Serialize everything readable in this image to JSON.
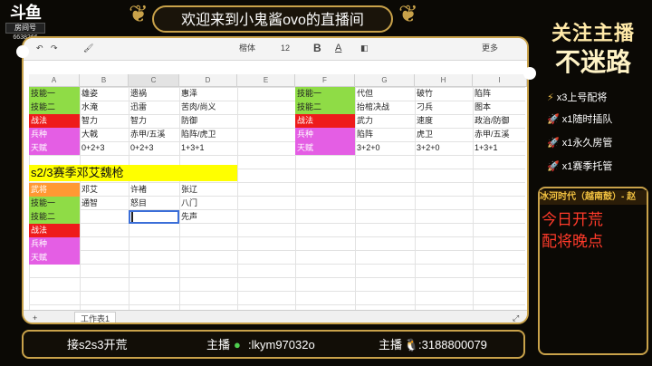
{
  "logo": {
    "brand": "斗鱼",
    "sub": "房间号",
    "room": "6638266"
  },
  "title": "欢迎来到小鬼酱ovo的直播间",
  "follow": {
    "line1": "关注主播",
    "line2": "不迷路"
  },
  "perks": [
    {
      "icon": "lightning-icon",
      "text": "x3上号配将"
    },
    {
      "icon": "rocket-icon",
      "text": "x1随时插队"
    },
    {
      "icon": "rocket-icon",
      "text": "x1永久房管"
    },
    {
      "icon": "rocket-icon",
      "text": "x1赛季托管"
    }
  ],
  "ticker": "冰河时代（越南鼓）- 赵",
  "notice": {
    "line1": "今日开荒",
    "line2": "配将晚点"
  },
  "bottom": {
    "left": "接s2s3开荒",
    "wechat_label": "主播",
    "wechat": ":lkym97032o",
    "qq_label": "主播",
    "qq": ":3188800079"
  },
  "toolbar": {
    "font": "楷体",
    "size": "12",
    "bold": "B",
    "more": "更多"
  },
  "columns": [
    "A",
    "B",
    "C",
    "D",
    "E",
    "F",
    "G",
    "H",
    "I"
  ],
  "colors": {
    "green": "#8fdc46",
    "red": "#ee1b1b",
    "pink": "#e45ee4",
    "orange": "#ff9933",
    "yellow": "#ffff00",
    "gold": "#c9a24a"
  },
  "table_left": {
    "rows": [
      {
        "label": "技能一",
        "cells": [
          "雄姿",
          "遗祸",
          "惠泽"
        ]
      },
      {
        "label": "技能二",
        "cells": [
          "水淹",
          "迅雷",
          "苦肉/尚义"
        ]
      },
      {
        "label": "战法",
        "cells": [
          "智力",
          "智力",
          "防御"
        ]
      },
      {
        "label": "兵种",
        "cells": [
          "大戟",
          "赤甲/五溪",
          "陷阵/虎卫"
        ]
      },
      {
        "label": "天赋",
        "cells": [
          "0+2+3",
          "0+2+3",
          "1+3+1"
        ]
      }
    ]
  },
  "table_right": {
    "rows": [
      {
        "label": "技能一",
        "cells": [
          "代但",
          "破竹",
          "陷阵"
        ]
      },
      {
        "label": "技能二",
        "cells": [
          "抬棺决战",
          "刁兵",
          "图本"
        ]
      },
      {
        "label": "战法",
        "cells": [
          "武力",
          "速度",
          "政治/防御"
        ]
      },
      {
        "label": "兵种",
        "cells": [
          "陷阵",
          "虎卫",
          "赤甲/五溪"
        ]
      },
      {
        "label": "天赋",
        "cells": [
          "3+2+0",
          "3+2+0",
          "1+3+1"
        ]
      }
    ]
  },
  "section2": {
    "title": "s2/3赛季邓艾魏枪",
    "rows": [
      {
        "label": "武将",
        "cells": [
          "邓艾",
          "许褚",
          "张辽"
        ]
      },
      {
        "label": "技能一",
        "cells": [
          "通智",
          "怒目",
          "八门"
        ]
      },
      {
        "label": "技能二",
        "cells": [
          "",
          "",
          "先声"
        ]
      },
      {
        "label": "战法",
        "cells": [
          "",
          "",
          ""
        ]
      },
      {
        "label": "兵种",
        "cells": [
          "",
          "",
          ""
        ]
      },
      {
        "label": "天赋",
        "cells": [
          "",
          "",
          ""
        ]
      }
    ]
  },
  "sheet_tab": "工作表1"
}
